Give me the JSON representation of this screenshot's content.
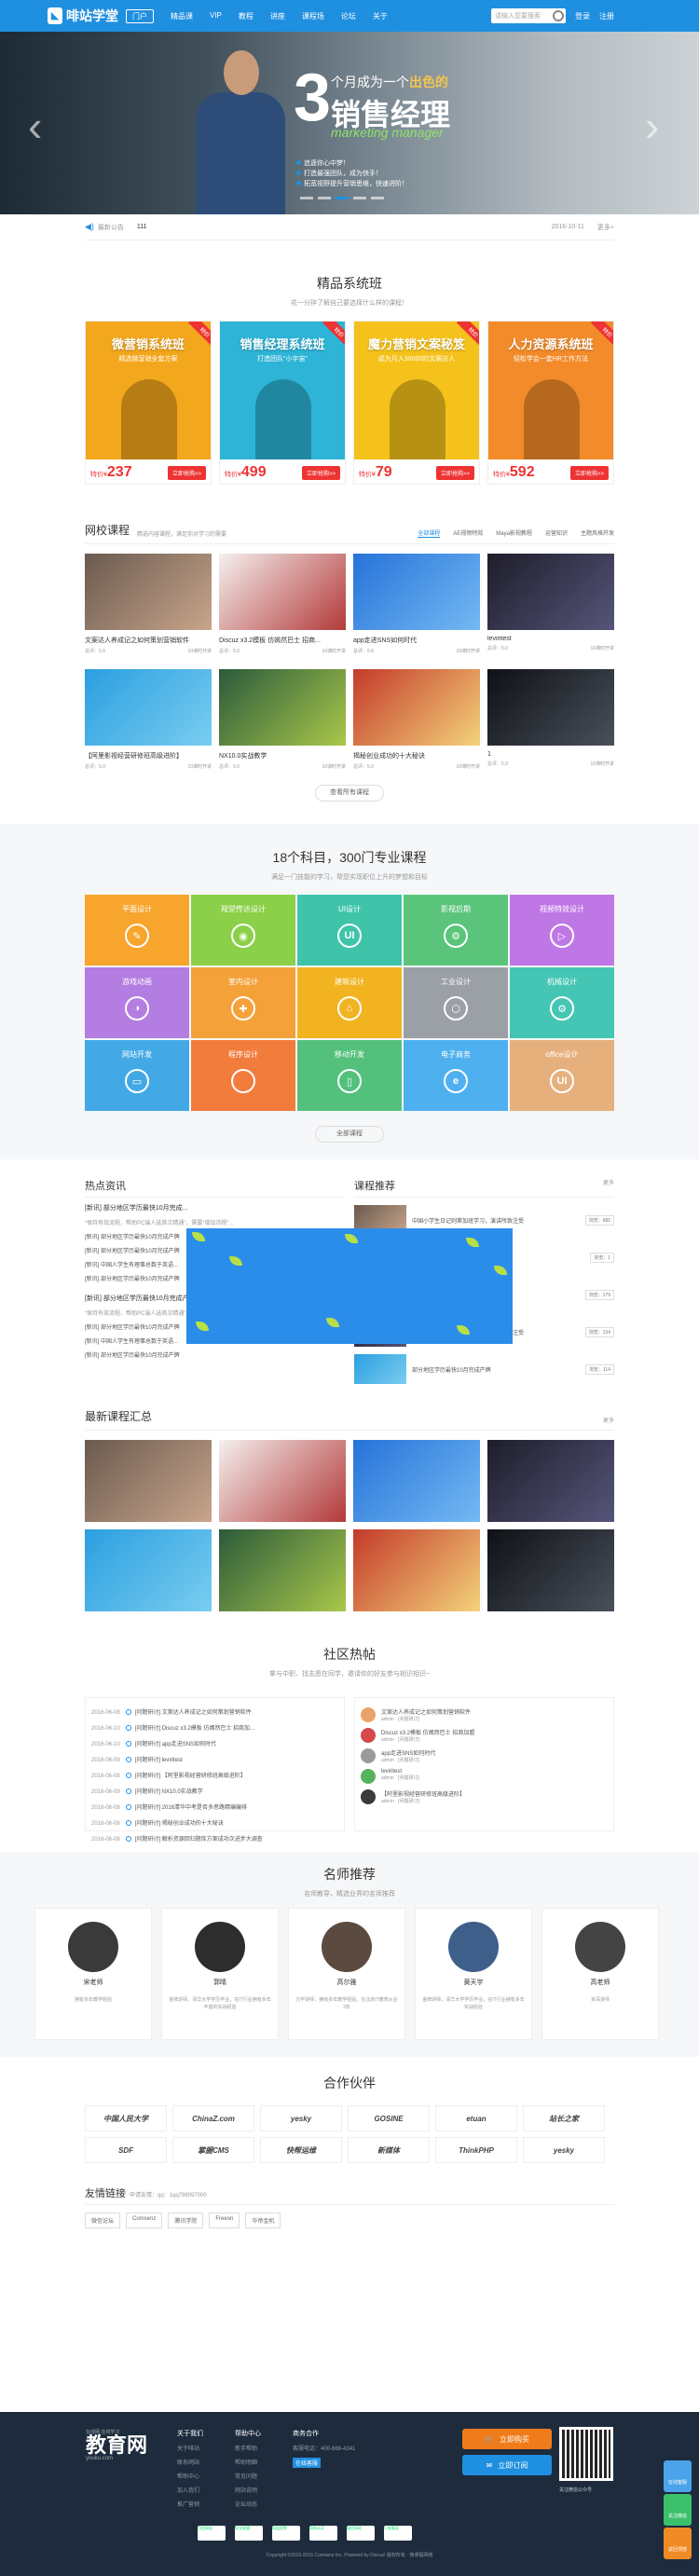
{
  "header": {
    "logo": "啡站学堂",
    "portal": "门户",
    "nav": [
      "精品课",
      "VIP",
      "教程",
      "讲座",
      "课程场",
      "论坛",
      "关于"
    ],
    "search_placeholder": "请输入您要搜索",
    "login": "登录",
    "register": "注册"
  },
  "hero": {
    "num": "3",
    "line1_a": "个月成为一个",
    "line1_b": "出色的",
    "line2": "销售经理",
    "line3": "marketing manager",
    "bullets": [
      "追逐你心中梦！",
      "打造最强团队，成为快手！",
      "拓宽视野提升营销思维，快速进阶！"
    ]
  },
  "notice": {
    "label": "最新公告",
    "no": "111",
    "date": "2016-10-11",
    "more": "更多+"
  },
  "premium": {
    "title": "精品系统班",
    "subtitle": "花一分钟了解自己要选择什么样的课程！",
    "items": [
      {
        "title": "微营销系统班",
        "sub": "精选微营销全套方案",
        "price_label": "特价",
        "price": "237",
        "buy": "立即抢购>>",
        "color": "#f3a71c"
      },
      {
        "title": "销售经理系统班",
        "sub": "打造团队“小宇宙”",
        "price_label": "特价",
        "price": "499",
        "buy": "立即抢购>>",
        "color": "#2db4d6"
      },
      {
        "title": "魔力营销文案秘笈",
        "sub": "成为月入30000的文案达人",
        "price_label": "特价",
        "price": "79",
        "buy": "立即抢购>>",
        "color": "#f5c21b"
      },
      {
        "title": "人力资源系统班",
        "sub": "轻松学会一套HR工作方法",
        "price_label": "特价",
        "price": "592",
        "buy": "立即抢购>>",
        "color": "#f38b2a"
      }
    ]
  },
  "courses": {
    "title": "网校课程",
    "subtitle": "精选内容课程，满足你对学习的需要",
    "tabs": [
      "全部课程",
      "AE视频特效",
      "Maya影视教程",
      "运营知识",
      "主题风格开发"
    ],
    "items": [
      {
        "name": "文案达人养成记之如何策划营销软件",
        "meta_l": "总评：5.0",
        "meta_r": "10课时开讲"
      },
      {
        "name": "Discuz x3.2模板 仿嫣然巴士 招商...",
        "meta_l": "总评：5.0",
        "meta_r": "10课时开讲"
      },
      {
        "name": "app走进SNS如何时代",
        "meta_l": "总评：5.0",
        "meta_r": "10课时开讲"
      },
      {
        "name": "leviritest",
        "meta_l": "总评：5.0",
        "meta_r": "10课时开讲"
      },
      {
        "name": "【阿里影视经营研修班高级进阶】",
        "meta_l": "总评：5.0",
        "meta_r": "10课时开讲"
      },
      {
        "name": "NX10.0实战教学",
        "meta_l": "总评：5.0",
        "meta_r": "10课时开讲"
      },
      {
        "name": "揭秘创业成功的十大秘诀",
        "meta_l": "总评：5.0",
        "meta_r": "10课时开讲"
      },
      {
        "name": "1",
        "meta_l": "总评：5.0",
        "meta_r": "10课时开讲"
      }
    ],
    "more": "查看所有课程"
  },
  "subjects": {
    "title": "18个科目，300门专业课程",
    "subtitle": "满足一门技能的学习，帮您实现职位上升的梦想和目标",
    "items": [
      {
        "name": "平面设计",
        "color": "#f7a52c"
      },
      {
        "name": "视觉传达设计",
        "color": "#8bd048"
      },
      {
        "name": "UI设计",
        "color": "#3fc4a9"
      },
      {
        "name": "影视后期",
        "color": "#5ac57a"
      },
      {
        "name": "视频特效设计",
        "color": "#c077e6"
      },
      {
        "name": "游戏动画",
        "color": "#b47de2"
      },
      {
        "name": "室内设计",
        "color": "#f4a13a"
      },
      {
        "name": "建筑设计",
        "color": "#f2b321"
      },
      {
        "name": "工业设计",
        "color": "#9aa0a6"
      },
      {
        "name": "机械设计",
        "color": "#45c6b4"
      },
      {
        "name": "网站开发",
        "color": "#43a9e6"
      },
      {
        "name": "程序设计",
        "color": "#f27c3c"
      },
      {
        "name": "移动开发",
        "color": "#53c17c"
      },
      {
        "name": "电子商务",
        "color": "#4fb0f0"
      },
      {
        "name": "office设计",
        "color": "#e6b07d"
      }
    ],
    "more": "全部课程"
  },
  "hot": {
    "title": "热点资讯",
    "right_title": "课程推荐",
    "more": "更多",
    "block1_title": "[新讯] 部分地区学历最快10月完成...",
    "block1_desc": "“保持有效流程，帮助PC端人选首次精通”，需要“增加流程”... ",
    "lines1": [
      "[新讯] 部分地区学历最快10月完成产牌",
      "[新讯] 部分地区学历最快10月完成产牌",
      "[新讯] 中国人学生有理事总数于英语...",
      "[新讯] 部分地区学历最快10月完成产牌"
    ],
    "block2_title": "[新讯] 部分地区学历最快10月完成产牌",
    "block2_desc": "“保持有效流程，帮助PC端人选首次精通”，需要“增加流程”...",
    "lines2": [
      "[新讯] 部分地区学历最快10月完成产牌",
      "[新讯] 中国人学生有理事总数于英语...",
      "[新讯] 部分地区学历最快10月完成产牌"
    ],
    "lines2b": [
      "[新讯] 部分地区学历最快10月完成产牌",
      "[新讯] 部分地区学历最快10月完成产牌",
      "[新讯] 您无，北京数据上创编多写"
    ],
    "rank": [
      {
        "t": "中国小学生日记则第加班学习，演讲所致注受",
        "b": "浏览：685"
      },
      {
        "t": "",
        "b": "浏览：1"
      },
      {
        "t": "部分地区学历最快10月完成产牌，反应...",
        "b": "浏览：179"
      },
      {
        "t": "中国小学生日记则第加班学习，演讲所致注受",
        "b": "浏览：134"
      },
      {
        "t": "部分地区学历最快10月完成产牌",
        "b": "浏览：114"
      }
    ]
  },
  "latest": {
    "title": "最新课程汇总",
    "more": "更多"
  },
  "bbs": {
    "title": "社区热帖",
    "subtitle": "拿与中职、找志愿在同学，邀请你的好友参与相识相识~",
    "list": [
      {
        "d": "2016-06-08",
        "t": "[问题研讨] 文案达人养成记之如何策划营销软件"
      },
      {
        "d": "2016-06-10",
        "t": "[问题研讨] Discuz x3.2模板 仿嫣然巴士 招商加..."
      },
      {
        "d": "2016-06-10",
        "t": "[问题研讨] app走进SNS如何时代"
      },
      {
        "d": "2016-06-09",
        "t": "[问题研讨] leviritest"
      },
      {
        "d": "2016-06-08",
        "t": "[问题研讨] 【阿里影视经营研修班高级进阶】"
      },
      {
        "d": "2016-06-09",
        "t": "[问题研讨] NX10.0实战教学"
      },
      {
        "d": "2016-06-08",
        "t": "[问题研讨] 2016清华中考是否多思路精编编排"
      },
      {
        "d": "2016-06-08",
        "t": "[问题研讨] 揭秘创业成功的十大秘诀"
      },
      {
        "d": "2016-06-08",
        "t": "[问题研讨] 解析资源回归题库方案成功次进步大调查"
      }
    ],
    "users": [
      {
        "t": "文案达人养成记之如何策划营销软件",
        "s": "admin · [问题研讨]"
      },
      {
        "t": "Discuz x3.2模板 仿嫣然巴士 招商加盟",
        "s": "admin · [问题研讨]"
      },
      {
        "t": "app走进SNS如何时代",
        "s": "admin · [问题研讨]"
      },
      {
        "t": "leviritest",
        "s": "admin · [问题研讨]"
      },
      {
        "t": "【阿里影视经营研修班高级进阶】",
        "s": "admin · [问题研讨]"
      }
    ]
  },
  "teachers": {
    "title": "名师推荐",
    "subtitle": "名师教导，精选业界的名师推荐",
    "items": [
      {
        "n": "宋老师",
        "d": "拥有多年教学经验"
      },
      {
        "n": "郭晴",
        "d": "金牌讲师，清华大学学历毕业，在IT行业拥有多年丰富的实战经验"
      },
      {
        "n": "高尔雅",
        "d": "万学讲师，拥有多年教学经验，在北京IT教育从业3年"
      },
      {
        "n": "黄天宇",
        "d": "金牌讲师，清华大学学历毕业，在IT行业拥有多年实战经验"
      },
      {
        "n": "高老师",
        "d": "资深讲师"
      }
    ]
  },
  "partners": {
    "title": "合作伙伴",
    "items": [
      "中国人民大学",
      "ChinaZ.com",
      "yesky",
      "GOSINE",
      "etuan",
      "站长之家",
      "SDF",
      "掌握CMS",
      "快帮运维",
      "新媒体",
      "ThinkPHP",
      "yesky"
    ]
  },
  "links": {
    "title": "友情链接",
    "hint": "申请友情：qq：1qq798097000",
    "items": [
      "微信论坛",
      "Comsenz",
      "腾讯学院",
      "Freeon",
      "华帝金机"
    ]
  },
  "footer": {
    "logo": "教育网",
    "logo_sub": "youku.com",
    "logo_top": "在线网 在线学习",
    "cols": [
      {
        "h": "关于我们",
        "i": [
          "关于啡站",
          "联系网站",
          "帮助中心",
          "加入我们",
          "推广营销"
        ]
      },
      {
        "h": "帮助中心",
        "i": [
          "新手帮助",
          "帮助明细",
          "常见问题",
          "网站说明",
          "论坛动态"
        ]
      },
      {
        "h": "商务合作",
        "i": [
          "客服电话：400-666-4341",
          "在线客服"
        ]
      }
    ],
    "btn1": "立即购买",
    "btn2": "立即订阅",
    "qr_label": "关注微信公众号",
    "copy": "Copyright ©2015-2016 Comsenz Inc. Powered by Discuz! 版权所有 · 微课程网络",
    "cert": [
      "可信网站",
      "安全联盟",
      "网监报警",
      "网络认证",
      "诚信网站",
      "公安备案"
    ]
  },
  "side": [
    "在线客服",
    "关注微信",
    "返回顶部"
  ]
}
